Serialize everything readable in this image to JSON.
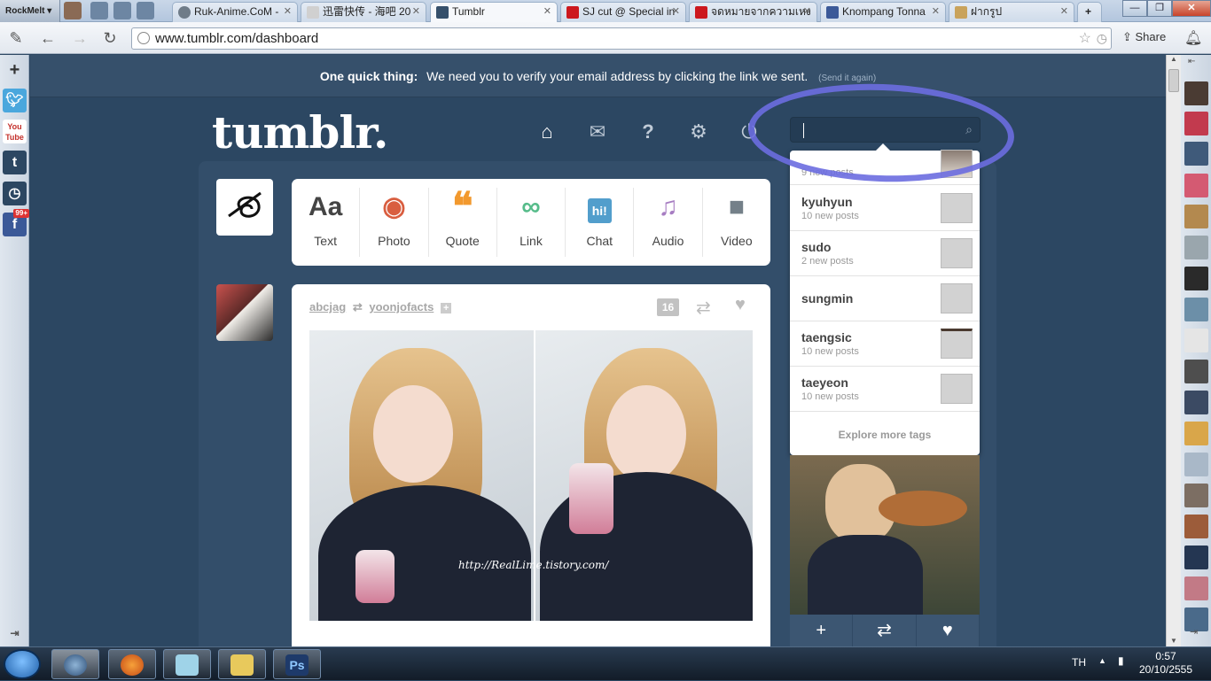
{
  "browser": {
    "brand": "RockMelt",
    "tabs": [
      {
        "label": "Ruk-Anime.CoM -",
        "fav_color": "#6f7c89"
      },
      {
        "label": "迅雷快传 - 海吧 20",
        "fav_color": "#d0d0d0"
      },
      {
        "label": "Tumblr",
        "fav_color": "#36506b",
        "active": true
      },
      {
        "label": "SJ cut @ Special in",
        "fav_color": "#cc181e"
      },
      {
        "label": "จดหมายจากความเหง",
        "fav_color": "#cc181e"
      },
      {
        "label": "Knompang Tonna",
        "fav_color": "#3b5998"
      },
      {
        "label": "ฝากรูป",
        "fav_color": "#c9a35c"
      }
    ],
    "url": "www.tumblr.com/dashboard",
    "share_label": "Share"
  },
  "left_sidebar": {
    "add_label": "+",
    "badge": "99+"
  },
  "banner": {
    "lead": "One quick thing:",
    "message": "We need you to verify your email address by clicking the link we sent.",
    "resend": "(Send it again)"
  },
  "header": {
    "logo": "tumblr.",
    "search_placeholder": ""
  },
  "post_types": [
    {
      "label": "Text",
      "icon": "Aa",
      "color": "#444444"
    },
    {
      "label": "Photo",
      "icon": "◉",
      "color": "#d95e40"
    },
    {
      "label": "Quote",
      "icon": "❝",
      "color": "#f2992e"
    },
    {
      "label": "Link",
      "icon": "∞",
      "color": "#56bc8a"
    },
    {
      "label": "Chat",
      "icon": "hi!",
      "color": "#529ecc"
    },
    {
      "label": "Audio",
      "icon": "♫",
      "color": "#a77dc2"
    },
    {
      "label": "Video",
      "icon": "■",
      "color": "#748089"
    }
  ],
  "post": {
    "author": "abcjag",
    "source": "yoonjofacts",
    "notes": "16",
    "watermark": "http://RealLime.tistory.com/"
  },
  "tag_dropdown": {
    "tags": [
      {
        "name": "",
        "sub": "9 new posts"
      },
      {
        "name": "kyuhyun",
        "sub": "10 new posts"
      },
      {
        "name": "sudo",
        "sub": "2 new posts"
      },
      {
        "name": "sungmin",
        "sub": ""
      },
      {
        "name": "taengsic",
        "sub": "10 new posts"
      },
      {
        "name": "taeyeon",
        "sub": "10 new posts"
      }
    ],
    "explore": "Explore more tags"
  },
  "taskbar": {
    "lang": "TH",
    "time": "0:57",
    "date": "20/10/2555"
  }
}
